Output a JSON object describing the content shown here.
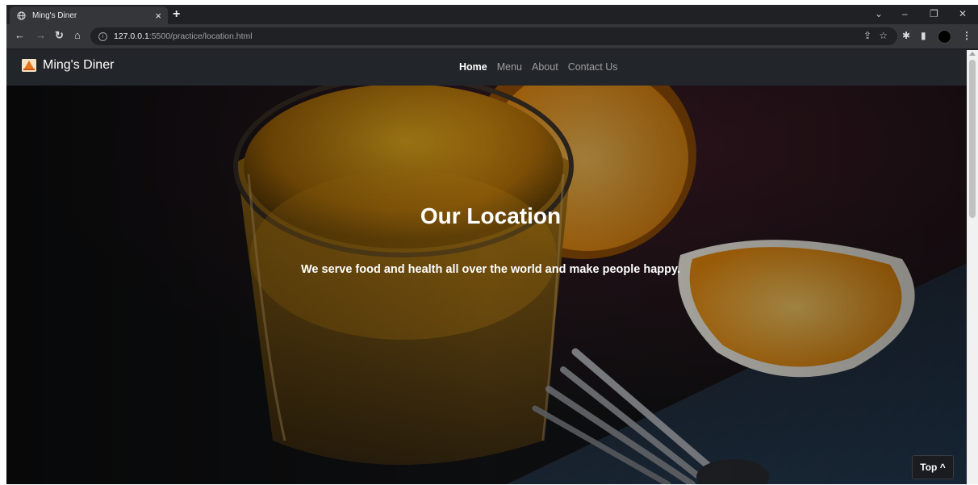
{
  "browser": {
    "tab_title": "Ming's Diner",
    "tab_close": "×",
    "new_tab": "+",
    "url_host": "127.0.0.1",
    "url_path": ":5500/practice/location.html",
    "window_controls": {
      "menu": "⌄",
      "minimize": "–",
      "restore": "❐",
      "close": "✕"
    },
    "nav": {
      "back": "←",
      "forward": "→",
      "reload": "↻",
      "home": "⌂"
    },
    "toolbar_icons": {
      "share": "⇪",
      "bookmark": "☆",
      "extensions": "✱",
      "sidepanel": "▮",
      "menu": "⋮"
    }
  },
  "navbar": {
    "brand": "Ming's Diner",
    "links": [
      "Home",
      "Menu",
      "About",
      "Contact Us"
    ],
    "active": "Home"
  },
  "hero": {
    "title": "Our Location",
    "subtitle": "We serve food and health all over the world and make people happy."
  },
  "top_button": "Top ^",
  "colors": {
    "navbar_bg": "#222529",
    "hero_overlay": "#141315",
    "juice": "#e09a12",
    "orange": "#f4a220"
  }
}
